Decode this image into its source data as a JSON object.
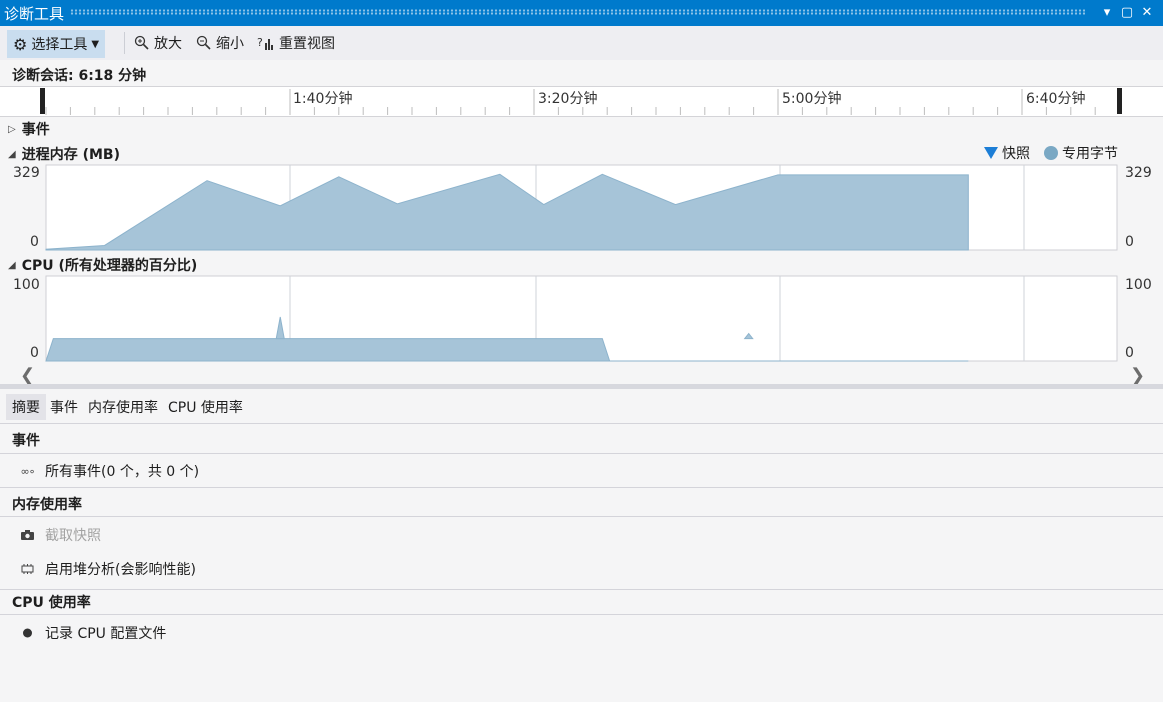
{
  "title_bar": {
    "title": "诊断工具"
  },
  "toolbar": {
    "select_tool": "选择工具",
    "zoom_in": "放大",
    "zoom_out": "缩小",
    "reset_view": "重置视图"
  },
  "session": {
    "label": "诊断会话: 6:18 分钟"
  },
  "timeline": {
    "ticks": [
      "1:40分钟",
      "3:20分钟",
      "5:00分钟",
      "6:40分钟"
    ]
  },
  "events_section": {
    "label": "事件"
  },
  "memory_section": {
    "label": "进程内存 (MB)",
    "y_max": "329",
    "y_min": "0",
    "legend": [
      {
        "label": "快照",
        "color": "#1c7ed6",
        "icon": "triangle-down-icon"
      },
      {
        "label": "专用字节",
        "color": "#7aa8c4",
        "icon": "circle-icon"
      }
    ],
    "fill_color": "#a6c4d8"
  },
  "cpu_section": {
    "label": "CPU (所有处理器的百分比)",
    "y_max": "100",
    "y_min": "0",
    "fill_color": "#a6c4d8"
  },
  "chart_data": [
    {
      "type": "area",
      "title": "进程内存 (MB)",
      "x_unit": "分钟",
      "ylim": [
        0,
        329
      ],
      "x": [
        0,
        0.4,
        1.1,
        1.6,
        2.0,
        2.4,
        3.1,
        3.4,
        3.8,
        4.3,
        5.0,
        6.3
      ],
      "values": [
        3,
        18,
        275,
        175,
        290,
        183,
        300,
        180,
        300,
        180,
        298,
        298
      ],
      "series_name": "专用字节"
    },
    {
      "type": "area",
      "title": "CPU (所有处理器的百分比)",
      "x_unit": "分钟",
      "ylim": [
        0,
        100
      ],
      "x": [
        0,
        0.05,
        3.8,
        3.85,
        6.3
      ],
      "values": [
        0,
        27,
        27,
        0,
        0
      ],
      "series_name": "CPU"
    }
  ],
  "tabs": [
    {
      "label": "摘要",
      "active": true
    },
    {
      "label": "事件",
      "active": false
    },
    {
      "label": "内存使用率",
      "active": false
    },
    {
      "label": "CPU 使用率",
      "active": false
    }
  ],
  "summary": {
    "events": {
      "header": "事件",
      "all_events": "所有事件(0 个，共 0 个)"
    },
    "memory": {
      "header": "内存使用率",
      "take_snapshot": "截取快照",
      "heap_profiling": "启用堆分析(会影响性能)"
    },
    "cpu": {
      "header": "CPU 使用率",
      "record_profile": "记录 CPU 配置文件"
    }
  }
}
